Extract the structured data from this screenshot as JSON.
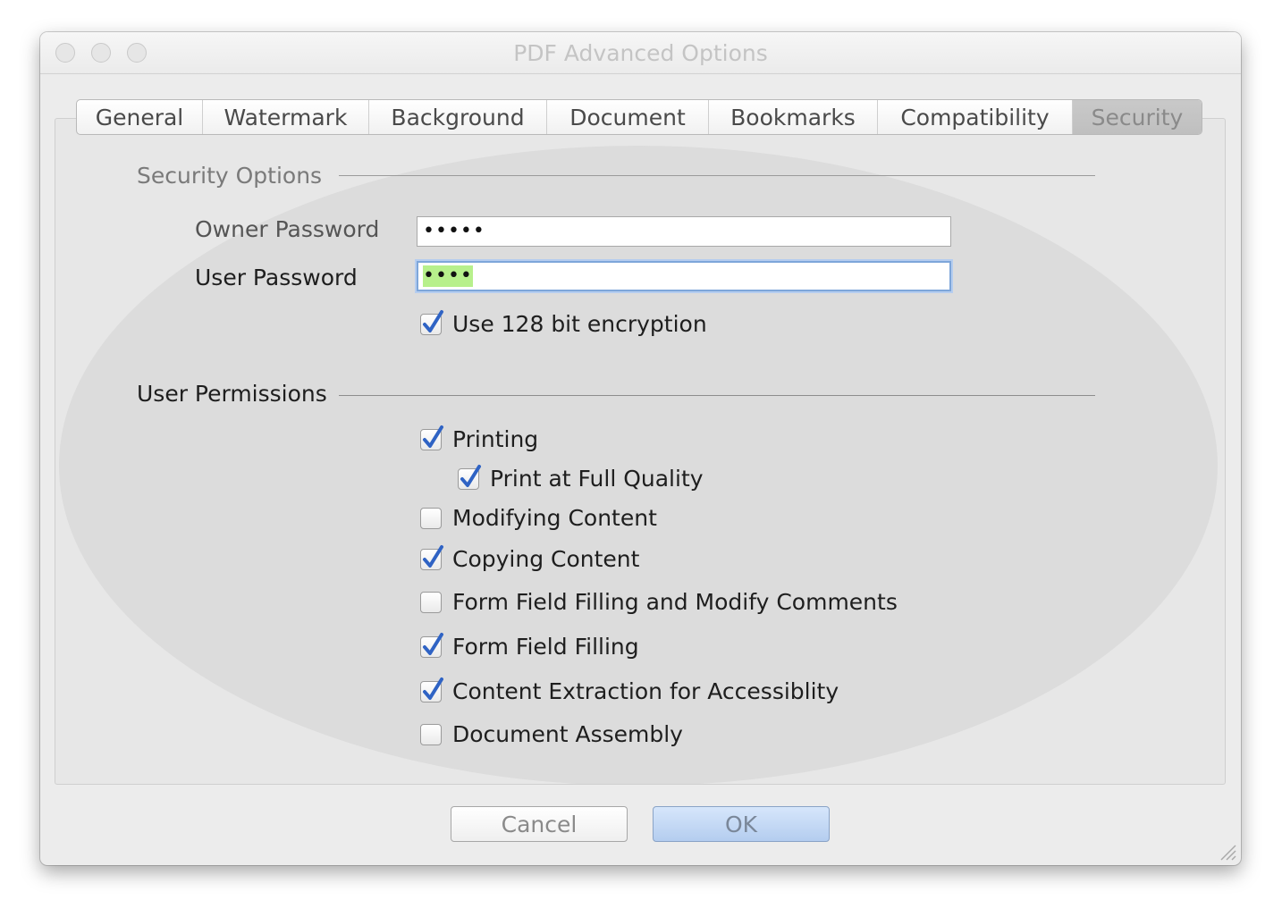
{
  "window": {
    "title": "PDF Advanced Options"
  },
  "tabs": [
    {
      "label": "General",
      "selected": false
    },
    {
      "label": "Watermark",
      "selected": false
    },
    {
      "label": "Background",
      "selected": false
    },
    {
      "label": "Document",
      "selected": false
    },
    {
      "label": "Bookmarks",
      "selected": false
    },
    {
      "label": "Compatibility",
      "selected": false
    },
    {
      "label": "Security",
      "selected": true
    }
  ],
  "security_options": {
    "title": "Security Options",
    "owner_password_label": "Owner Password",
    "owner_password_value": "•••••",
    "user_password_label": "User Password",
    "user_password_value": "••••",
    "encryption_label": "Use 128 bit encryption",
    "encryption_checked": true
  },
  "user_permissions": {
    "title": "User Permissions",
    "items": [
      {
        "label": "Printing",
        "checked": true
      },
      {
        "label": "Print at Full Quality",
        "checked": true
      },
      {
        "label": "Modifying Content",
        "checked": false
      },
      {
        "label": "Copying Content",
        "checked": true
      },
      {
        "label": "Form Field Filling and Modify Comments",
        "checked": false
      },
      {
        "label": "Form Field Filling",
        "checked": true
      },
      {
        "label": "Content Extraction for Accessiblity",
        "checked": true
      },
      {
        "label": "Document Assembly",
        "checked": false
      }
    ]
  },
  "buttons": {
    "cancel": "Cancel",
    "ok": "OK"
  },
  "colors": {
    "window_bg": "#ececec",
    "check_blue": "#2f63c4",
    "selection_green": "#b7f08c",
    "focus_ring": "#7ea6da"
  }
}
